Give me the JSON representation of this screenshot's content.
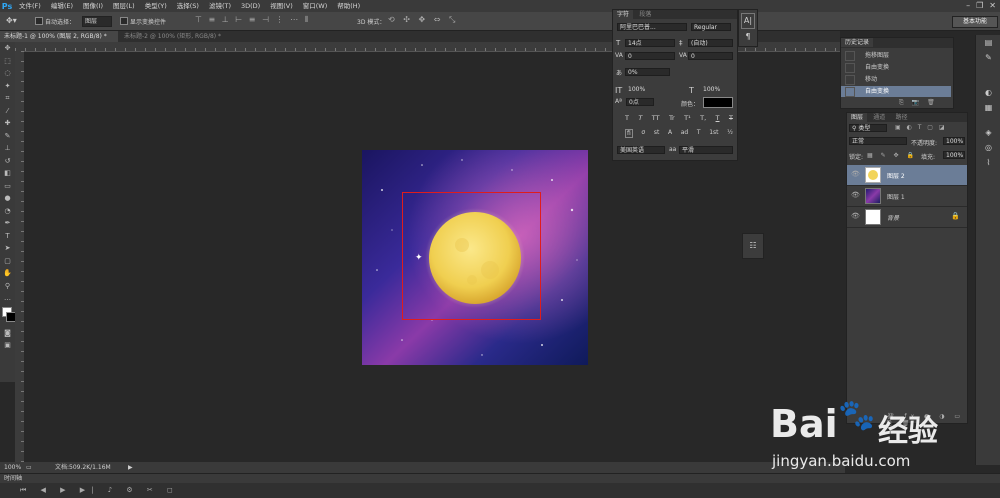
{
  "menubar": {
    "logo": "Ps",
    "items": [
      "文件(F)",
      "编辑(E)",
      "图像(I)",
      "图层(L)",
      "类型(Y)",
      "选择(S)",
      "滤镜(T)",
      "3D(D)",
      "视图(V)",
      "窗口(W)",
      "帮助(H)"
    ],
    "window_controls": [
      "–",
      "❐",
      "✕"
    ]
  },
  "options": {
    "auto_select_label": "自动选择：",
    "auto_select_value": "图层",
    "show_transform_label": "显示变换控件",
    "mode_label": "3D 模式：",
    "workspace": "基本功能"
  },
  "tabs": [
    {
      "label": "未标题-1 @ 100% (图层 2, RGB/8) *"
    },
    {
      "label": "未标题-2 @ 100% (矩形, RGB/8) *"
    }
  ],
  "status": {
    "zoom": "100%",
    "doc": "文档:509.2K/1.16M"
  },
  "timeline": {
    "label": "时间轴"
  },
  "character_panel": {
    "tabs": [
      "字符",
      "段落"
    ],
    "font_family": "阿里巴巴普...",
    "font_style": "Regular",
    "size": "14点",
    "leading": "(自动)",
    "kerning": "0",
    "tracking": "0",
    "scale_percent": "0%",
    "vertical_scale": "100%",
    "horizontal_scale": "100%",
    "baseline": "0点",
    "color_label": "颜色：",
    "style_buttons": [
      "T",
      "T",
      "TT",
      "Tr",
      "T¹",
      "T,",
      "T",
      "T"
    ],
    "opentype_buttons": [
      "fi",
      "σ",
      "st",
      "A",
      "ad",
      "T",
      "1st",
      "½"
    ],
    "language": "美国英语",
    "aa_label": "aa",
    "antialias": "平滑"
  },
  "history_panel": {
    "tab": "历史记录",
    "items": [
      {
        "label": "拖移图层",
        "active": false
      },
      {
        "label": "自由变换",
        "active": false
      },
      {
        "label": "移动",
        "active": false
      },
      {
        "label": "自由变换",
        "active": true
      }
    ]
  },
  "layers_panel": {
    "tabs": [
      "图层",
      "通道",
      "路径"
    ],
    "filter": "类型",
    "blend_mode": "正常",
    "opacity_label": "不透明度:",
    "opacity": "100%",
    "lock_label": "锁定:",
    "fill_label": "填充:",
    "fill": "100%",
    "layers": [
      {
        "name": "图层 2",
        "selected": true,
        "locked": false
      },
      {
        "name": "图层 1",
        "selected": false,
        "locked": false
      },
      {
        "name": "背景",
        "selected": false,
        "locked": true
      }
    ]
  },
  "watermark": {
    "brand": "Bai",
    "brand_suffix": "经验",
    "url": "jingyan.baidu.com"
  },
  "colors": {
    "accent": "#2fa7f5",
    "selection": "#e01c1c",
    "moon": "#f2d45a"
  }
}
